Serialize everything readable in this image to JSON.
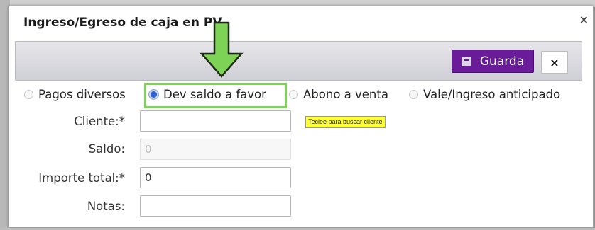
{
  "dialog": {
    "title": "Ingreso/Egreso de caja en PV",
    "close_label": "×"
  },
  "toolbar": {
    "save_label": "Guarda",
    "cancel_label": "×"
  },
  "radio_options": [
    {
      "label": "Pagos diversos",
      "selected": false
    },
    {
      "label": "Dev saldo a favor",
      "selected": true
    },
    {
      "label": "Abono a venta",
      "selected": false
    },
    {
      "label": "Vale/Ingreso anticipado",
      "selected": false
    }
  ],
  "form": {
    "cliente": {
      "label": "Cliente:*",
      "value": "",
      "hint": "Teclee para buscar cliente"
    },
    "saldo": {
      "label": "Saldo:",
      "value": "0"
    },
    "importe": {
      "label": "Importe total:*",
      "value": "0"
    },
    "notas": {
      "label": "Notas:",
      "value": ""
    }
  },
  "annotation": {
    "arrow_icon": "down-arrow-icon",
    "highlight_color": "#7dd355"
  },
  "colors": {
    "accent": "#6a1b9a",
    "radio_selected": "#2f5fd4",
    "hint_bg": "#ffff33"
  }
}
